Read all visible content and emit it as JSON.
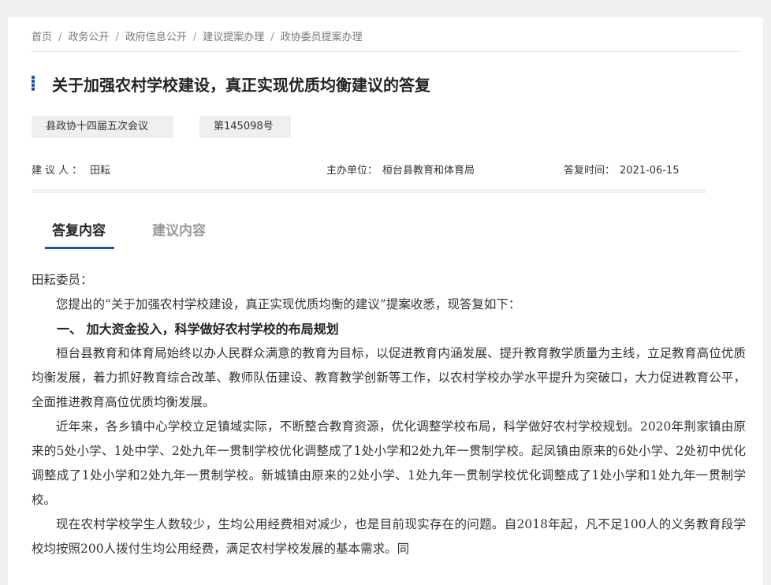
{
  "breadcrumb": [
    "首页",
    "政务公开",
    "政府信息公开",
    "建议提案办理",
    "政协委员提案办理"
  ],
  "title": "关于加强农村学校建设，真正实现优质均衡建议的答复",
  "tags": {
    "session": "县政协十四届五次会议",
    "number": "第145098号"
  },
  "meta": {
    "proposer_label": "建议人：",
    "proposer": "田耘",
    "dept_label": "主办单位：",
    "dept": "桓台县教育和体育局",
    "date_label": "答复时间：",
    "date": "2021-06-15"
  },
  "tabs": {
    "reply": "答复内容",
    "suggest": "建议内容"
  },
  "content": {
    "salutation": "田耘委员：",
    "intro": "您提出的“关于加强农村学校建设，真正实现优质均衡的建议”提案收悉，现答复如下：",
    "heading1": "一、  加大资金投入，科学做好农村学校的布局规划",
    "para1": "桓台县教育和体育局始终以办人民群众满意的教育为目标，以促进教育内涵发展、提升教育教学质量为主线，立足教育高位优质均衡发展，着力抓好教育综合改革、教师队伍建设、教育教学创新等工作，以农村学校办学水平提升为突破口，大力促进教育公平，全面推进教育高位优质均衡发展。",
    "para2": "近年来，各乡镇中心学校立足镇域实际，不断整合教育资源，优化调整学校布局，科学做好农村学校规划。2020年荆家镇由原来的5处小学、1处中学、2处九年一贯制学校优化调整成了1处小学和2处九年一贯制学校。起凤镇由原来的6处小学、2处初中优化调整成了1处小学和2处九年一贯制学校。新城镇由原来的2处小学、1处九年一贯制学校优化调整成了1处小学和1处九年一贯制学校。",
    "para3": "现在农村学校学生人数较少，生均公用经费相对减少，也是目前现实存在的问题。自2018年起，凡不足100人的义务教育段学校均按照200人拨付生均公用经费，满足农村学校发展的基本需求。同"
  }
}
